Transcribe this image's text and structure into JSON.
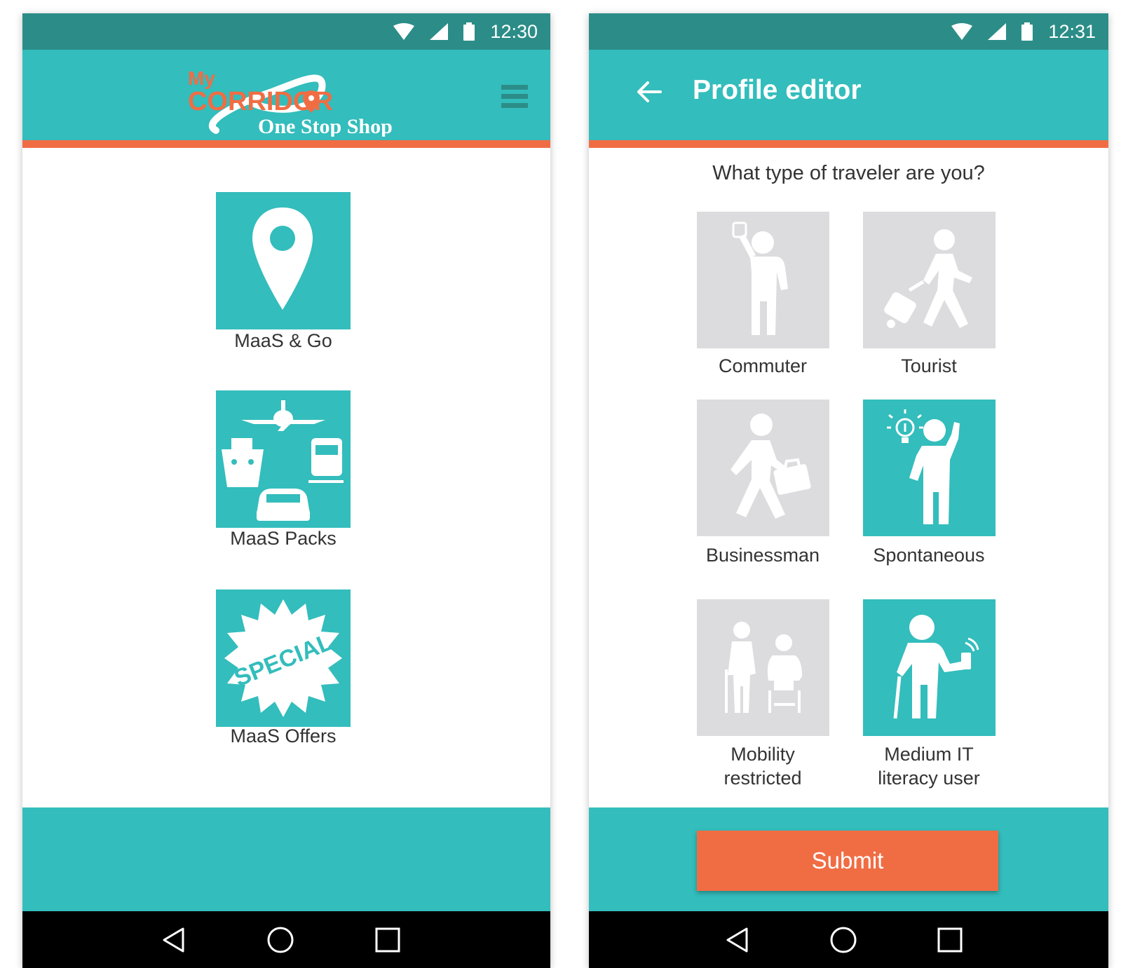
{
  "left_screen": {
    "status": {
      "time": "12:30"
    },
    "logo": {
      "line1": "My",
      "line2": "CORRIDOR",
      "line3": "One Stop Shop",
      "icon": "myCorridor-logo"
    },
    "menu": {
      "icon": "hamburger-menu-icon"
    },
    "tiles": [
      {
        "label": "MaaS & Go",
        "icon": "map-pin-icon"
      },
      {
        "label": "MaaS Packs",
        "icon": "transport-modes-icon"
      },
      {
        "label": "MaaS Offers",
        "icon": "special-badge-icon",
        "badge_text": "SPECIAL"
      }
    ]
  },
  "right_screen": {
    "status": {
      "time": "12:31"
    },
    "title": "Profile editor",
    "question": "What type of traveler are you?",
    "options": [
      {
        "label": "Commuter",
        "selected": false,
        "icon": "commuter-icon"
      },
      {
        "label": "Tourist",
        "selected": false,
        "icon": "tourist-icon"
      },
      {
        "label": "Businessman",
        "selected": false,
        "icon": "businessman-icon"
      },
      {
        "label": "Spontaneous",
        "selected": true,
        "icon": "spontaneous-icon"
      },
      {
        "label_line1": "Mobility",
        "label_line2": "restricted",
        "selected": false,
        "icon": "mobility-restricted-icon"
      },
      {
        "label_line1": "Medium IT",
        "label_line2": "literacy user",
        "selected": true,
        "icon": "medium-it-literacy-icon"
      }
    ],
    "submit_label": "Submit"
  },
  "colors": {
    "teal": "#33bdbc",
    "dark_teal": "#2c8d88",
    "orange": "#f06d44",
    "tile_gray": "#dcdcde"
  }
}
